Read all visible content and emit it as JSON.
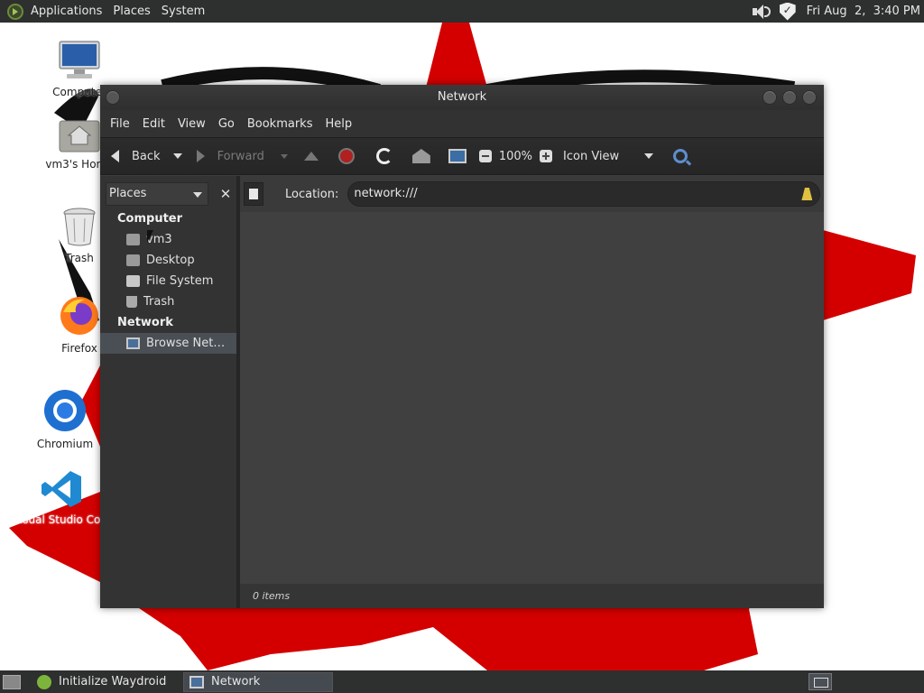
{
  "top_panel": {
    "menus": [
      "Applications",
      "Places",
      "System"
    ],
    "clock": "Fri Aug  2,  3:40 PM"
  },
  "desktop": {
    "icons": [
      {
        "label": "Computer",
        "icon": "computer-icon"
      },
      {
        "label": "vm3's Home",
        "icon": "home-folder-icon"
      },
      {
        "label": "Trash",
        "icon": "trash-icon"
      },
      {
        "label": "Firefox",
        "icon": "firefox-icon"
      },
      {
        "label": "Chromium",
        "icon": "chromium-icon"
      },
      {
        "label": "Visual Studio Code",
        "icon": "vscode-icon"
      }
    ]
  },
  "window": {
    "title": "Network",
    "menubar": [
      "File",
      "Edit",
      "View",
      "Go",
      "Bookmarks",
      "Help"
    ],
    "toolbar": {
      "back_label": "Back",
      "forward_label": "Forward",
      "zoom_level": "100%",
      "view_mode": "Icon View"
    },
    "sidebar": {
      "selector": "Places",
      "sections": [
        {
          "heading": "Computer",
          "items": [
            {
              "label": "vm3",
              "icon": "home-folder-icon"
            },
            {
              "label": "Desktop",
              "icon": "desktop-folder-icon"
            },
            {
              "label": "File System",
              "icon": "filesystem-icon"
            },
            {
              "label": "Trash",
              "icon": "trash-icon"
            }
          ]
        },
        {
          "heading": "Network",
          "items": [
            {
              "label": "Browse Net…",
              "icon": "network-icon",
              "selected": true
            }
          ]
        }
      ]
    },
    "location": {
      "label": "Location:",
      "value": "network:///"
    },
    "status": "0 items"
  },
  "taskbar": {
    "tasks": [
      {
        "label": "Initialize Waydroid",
        "icon": "waydroid-icon",
        "active": false
      },
      {
        "label": "Network",
        "icon": "network-icon",
        "active": true
      }
    ]
  },
  "colors": {
    "panel": "#2e2f2f",
    "window_bg": "#3c3c3c",
    "content_bg": "#404040",
    "wallpaper_red": "#d40000"
  }
}
